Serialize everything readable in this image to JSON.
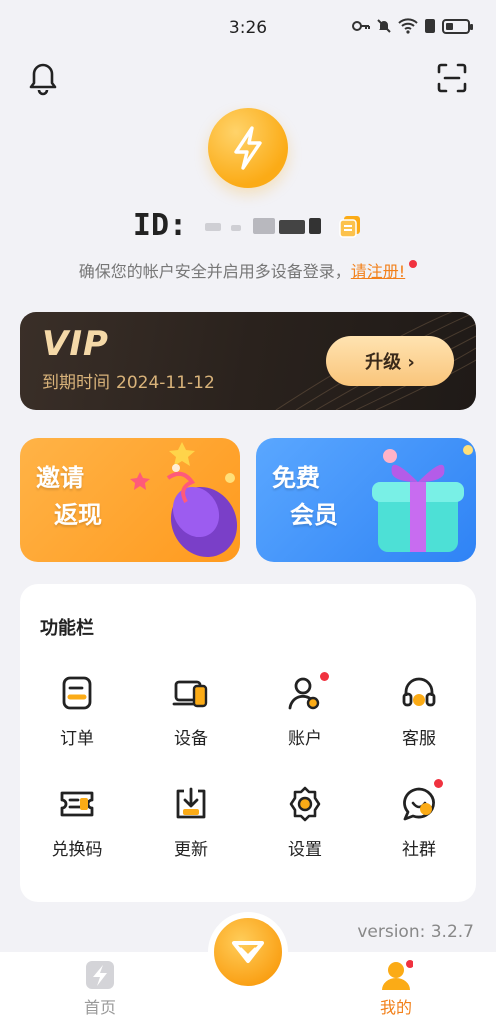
{
  "status_bar": {
    "time": "3:26"
  },
  "header": {
    "id_label": "ID:"
  },
  "tip": {
    "text": "确保您的帐户安全并启用多设备登录，",
    "link": "请注册!"
  },
  "vip": {
    "title": "VIP",
    "expire_label": "到期时间",
    "expire_date": "2024-11-12",
    "upgrade_label": "升级 ›"
  },
  "promos": [
    {
      "line1": "邀请",
      "line2": "返现"
    },
    {
      "line1": "免费",
      "line2": "会员"
    }
  ],
  "functions": {
    "title": "功能栏",
    "items": [
      {
        "label": "订单",
        "icon": "order-icon"
      },
      {
        "label": "设备",
        "icon": "device-icon"
      },
      {
        "label": "账户",
        "icon": "account-icon"
      },
      {
        "label": "客服",
        "icon": "support-icon"
      },
      {
        "label": "兑换码",
        "icon": "redeem-icon"
      },
      {
        "label": "更新",
        "icon": "update-icon"
      },
      {
        "label": "设置",
        "icon": "settings-icon"
      },
      {
        "label": "社群",
        "icon": "community-icon"
      }
    ]
  },
  "version": "version: 3.2.7",
  "nav": {
    "home": "首页",
    "me": "我的"
  },
  "colors": {
    "accent": "#f2801a",
    "primary_yellow": "#fbab16",
    "badge_red": "#f0323f"
  }
}
